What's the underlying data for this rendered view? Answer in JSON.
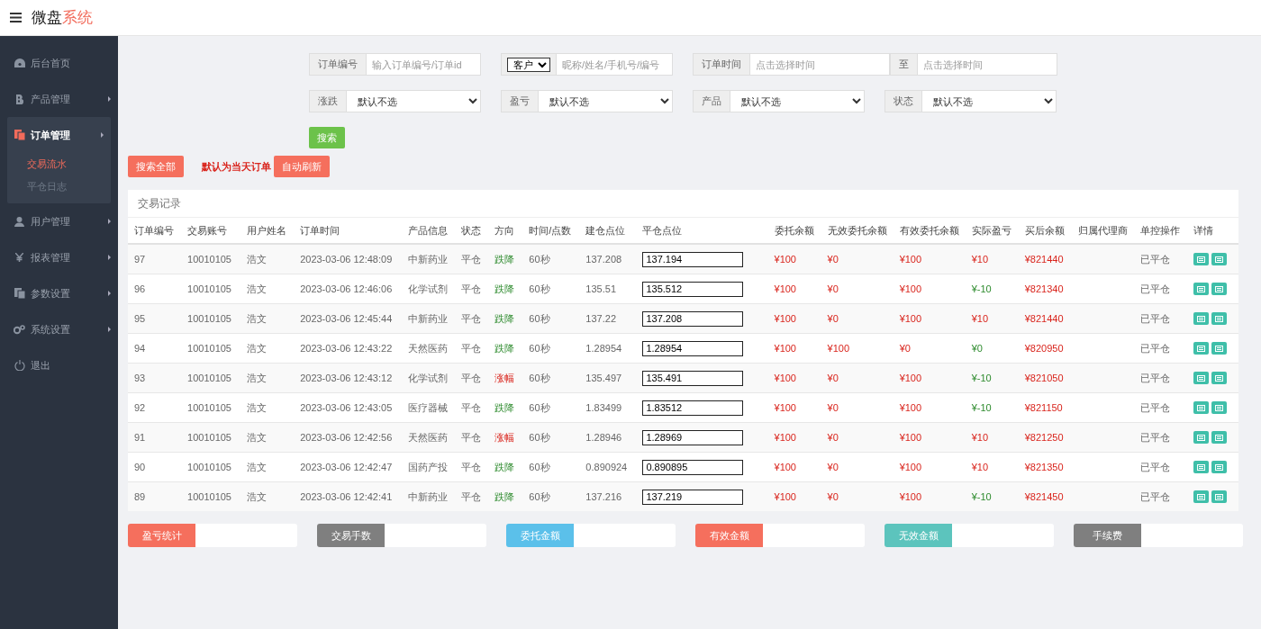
{
  "topbar": {
    "logo_main": "微盘",
    "logo_accent": "系统"
  },
  "sidebar": {
    "items": [
      {
        "label": "后台首页",
        "submenu": false,
        "expanded": false
      },
      {
        "label": "产品管理",
        "submenu": true,
        "expanded": false
      },
      {
        "label": "订单管理",
        "submenu": true,
        "expanded": true,
        "children": [
          {
            "label": "交易流水",
            "selected": true
          },
          {
            "label": "平仓日志",
            "selected": false
          }
        ]
      },
      {
        "label": "用户管理",
        "submenu": true,
        "expanded": false
      },
      {
        "label": "报表管理",
        "submenu": true,
        "expanded": false
      },
      {
        "label": "参数设置",
        "submenu": true,
        "expanded": false
      },
      {
        "label": "系统设置",
        "submenu": true,
        "expanded": false
      },
      {
        "label": "退出",
        "submenu": false,
        "expanded": false
      }
    ]
  },
  "filters": {
    "order_no": {
      "label": "订单编号",
      "placeholder": "输入订单编号/订单id"
    },
    "customer": {
      "select": "客户",
      "placeholder": "昵称/姓名/手机号/编号"
    },
    "time": {
      "label": "订单时间",
      "from_placeholder": "点击选择时间",
      "separator": "至",
      "to_placeholder": "点击选择时间"
    },
    "selects": [
      {
        "label": "涨跌",
        "value": "默认不选"
      },
      {
        "label": "盈亏",
        "value": "默认不选"
      },
      {
        "label": "产品",
        "value": "默认不选"
      },
      {
        "label": "状态",
        "value": "默认不选"
      }
    ],
    "search_button": "搜索"
  },
  "actions": {
    "search_all": "搜索全部",
    "note": "默认为当天订单",
    "auto_refresh": "自动刷新"
  },
  "table": {
    "title": "交易记录",
    "columns": [
      "订单编号",
      "交易账号",
      "用户姓名",
      "订单时间",
      "产品信息",
      "状态",
      "方向",
      "时间/点数",
      "建仓点位",
      "平仓点位",
      "委托余额",
      "无效委托余额",
      "有效委托余额",
      "实际盈亏",
      "买后余额",
      "归属代理商",
      "单控操作",
      "详情"
    ],
    "rows": [
      {
        "id": "97",
        "account": "10010105",
        "name": "浩文",
        "time": "2023-03-06 12:48:09",
        "product": "中新药业",
        "status": "平仓",
        "direction": {
          "text": "跌降",
          "kind": "down"
        },
        "duration": "60秒",
        "open_price": "137.208",
        "close_price": "137.194",
        "entrust": "¥100",
        "invalid": "¥0",
        "valid": "¥100",
        "pnl": {
          "text": "¥10",
          "kind": "gain"
        },
        "balance": "¥821440",
        "control": "已平仓"
      },
      {
        "id": "96",
        "account": "10010105",
        "name": "浩文",
        "time": "2023-03-06 12:46:06",
        "product": "化学试剂",
        "status": "平仓",
        "direction": {
          "text": "跌降",
          "kind": "down"
        },
        "duration": "60秒",
        "open_price": "135.51",
        "close_price": "135.512",
        "entrust": "¥100",
        "invalid": "¥0",
        "valid": "¥100",
        "pnl": {
          "text": "¥-10",
          "kind": "loss"
        },
        "balance": "¥821340",
        "control": "已平仓"
      },
      {
        "id": "95",
        "account": "10010105",
        "name": "浩文",
        "time": "2023-03-06 12:45:44",
        "product": "中新药业",
        "status": "平仓",
        "direction": {
          "text": "跌降",
          "kind": "down"
        },
        "duration": "60秒",
        "open_price": "137.22",
        "close_price": "137.208",
        "entrust": "¥100",
        "invalid": "¥0",
        "valid": "¥100",
        "pnl": {
          "text": "¥10",
          "kind": "gain"
        },
        "balance": "¥821440",
        "control": "已平仓"
      },
      {
        "id": "94",
        "account": "10010105",
        "name": "浩文",
        "time": "2023-03-06 12:43:22",
        "product": "天然医药",
        "status": "平仓",
        "direction": {
          "text": "跌降",
          "kind": "down"
        },
        "duration": "60秒",
        "open_price": "1.28954",
        "close_price": "1.28954",
        "entrust": "¥100",
        "invalid": "¥100",
        "valid": "¥0",
        "pnl": {
          "text": "¥0",
          "kind": "loss"
        },
        "balance": "¥820950",
        "control": "已平仓"
      },
      {
        "id": "93",
        "account": "10010105",
        "name": "浩文",
        "time": "2023-03-06 12:43:12",
        "product": "化学试剂",
        "status": "平仓",
        "direction": {
          "text": "涨幅",
          "kind": "up"
        },
        "duration": "60秒",
        "open_price": "135.497",
        "close_price": "135.491",
        "entrust": "¥100",
        "invalid": "¥0",
        "valid": "¥100",
        "pnl": {
          "text": "¥-10",
          "kind": "loss"
        },
        "balance": "¥821050",
        "control": "已平仓"
      },
      {
        "id": "92",
        "account": "10010105",
        "name": "浩文",
        "time": "2023-03-06 12:43:05",
        "product": "医疗器械",
        "status": "平仓",
        "direction": {
          "text": "跌降",
          "kind": "down"
        },
        "duration": "60秒",
        "open_price": "1.83499",
        "close_price": "1.83512",
        "entrust": "¥100",
        "invalid": "¥0",
        "valid": "¥100",
        "pnl": {
          "text": "¥-10",
          "kind": "loss"
        },
        "balance": "¥821150",
        "control": "已平仓"
      },
      {
        "id": "91",
        "account": "10010105",
        "name": "浩文",
        "time": "2023-03-06 12:42:56",
        "product": "天然医药",
        "status": "平仓",
        "direction": {
          "text": "涨幅",
          "kind": "up"
        },
        "duration": "60秒",
        "open_price": "1.28946",
        "close_price": "1.28969",
        "entrust": "¥100",
        "invalid": "¥0",
        "valid": "¥100",
        "pnl": {
          "text": "¥10",
          "kind": "gain"
        },
        "balance": "¥821250",
        "control": "已平仓"
      },
      {
        "id": "90",
        "account": "10010105",
        "name": "浩文",
        "time": "2023-03-06 12:42:47",
        "product": "国药产投",
        "status": "平仓",
        "direction": {
          "text": "跌降",
          "kind": "down"
        },
        "duration": "60秒",
        "open_price": "0.890924",
        "close_price": "0.890895",
        "entrust": "¥100",
        "invalid": "¥0",
        "valid": "¥100",
        "pnl": {
          "text": "¥10",
          "kind": "gain"
        },
        "balance": "¥821350",
        "control": "已平仓"
      },
      {
        "id": "89",
        "account": "10010105",
        "name": "浩文",
        "time": "2023-03-06 12:42:41",
        "product": "中新药业",
        "status": "平仓",
        "direction": {
          "text": "跌降",
          "kind": "down"
        },
        "duration": "60秒",
        "open_price": "137.216",
        "close_price": "137.219",
        "entrust": "¥100",
        "invalid": "¥0",
        "valid": "¥100",
        "pnl": {
          "text": "¥-10",
          "kind": "loss"
        },
        "balance": "¥821450",
        "control": "已平仓"
      }
    ]
  },
  "stats": [
    {
      "label": "盈亏统计",
      "color": "#f56f5d"
    },
    {
      "label": "交易手数",
      "color": "#7f7f7f"
    },
    {
      "label": "委托金额",
      "color": "#5bc0ea"
    },
    {
      "label": "有效金额",
      "color": "#f56f5d"
    },
    {
      "label": "无效金额",
      "color": "#5cc4bd"
    },
    {
      "label": "手续费",
      "color": "#7f7f7f"
    }
  ]
}
